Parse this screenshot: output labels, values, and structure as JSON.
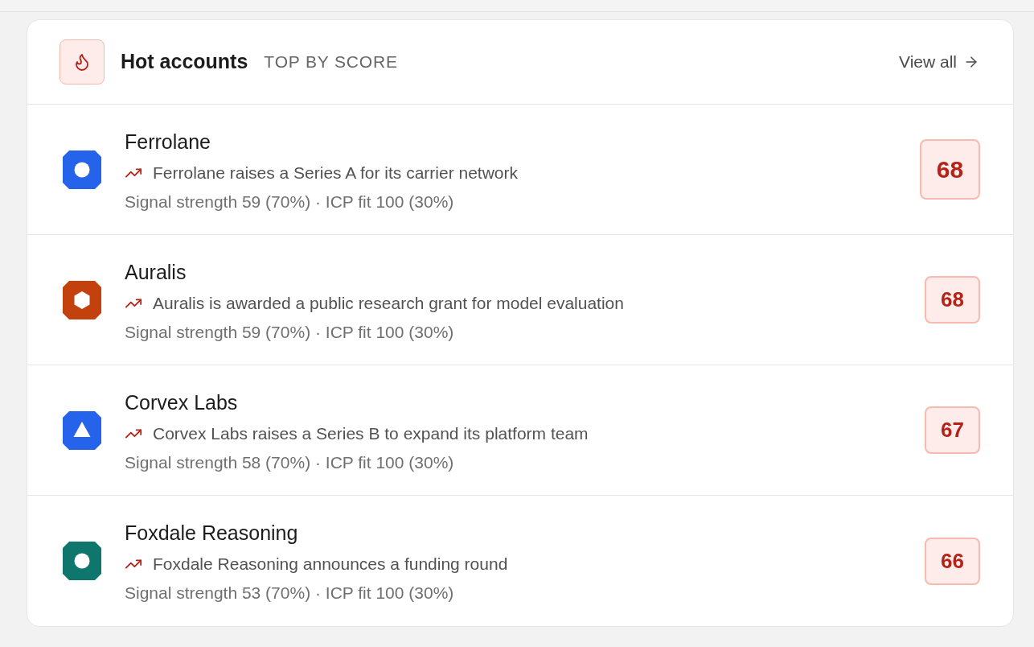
{
  "header": {
    "title": "Hot accounts",
    "subtitle": "TOP BY SCORE",
    "link": "View all"
  },
  "accounts": [
    {
      "name": "Ferrolane",
      "logo": {
        "kind": "circle",
        "color": "#2563eb"
      },
      "signal": "Ferrolane raises a Series A for its carrier network",
      "breakdown": "Signal strength 59 (70%) · ICP fit 100 (30%)",
      "score": "68",
      "highlighted": true
    },
    {
      "name": "Auralis",
      "logo": {
        "kind": "hexagon",
        "color": "#c2410c"
      },
      "signal": "Auralis is awarded a public research grant for model evaluation",
      "breakdown": "Signal strength 59 (70%) · ICP fit 100 (30%)",
      "score": "68",
      "highlighted": false
    },
    {
      "name": "Corvex Labs",
      "logo": {
        "kind": "triangle",
        "color": "#2563eb"
      },
      "signal": "Corvex Labs raises a Series B to expand its platform team",
      "breakdown": "Signal strength 58 (70%) · ICP fit 100 (30%)",
      "score": "67",
      "highlighted": false
    },
    {
      "name": "Foxdale Reasoning",
      "logo": {
        "kind": "circle",
        "color": "#0f766e"
      },
      "signal": "Foxdale Reasoning announces a funding round",
      "breakdown": "Signal strength 53 (70%) · ICP fit 100 (30%)",
      "score": "66",
      "highlighted": false
    }
  ]
}
